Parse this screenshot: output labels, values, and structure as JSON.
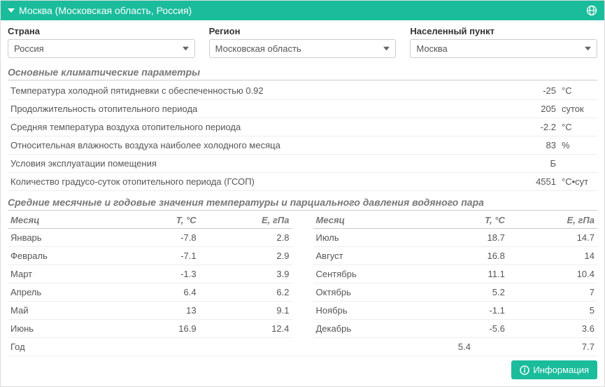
{
  "header": {
    "title": "Москва (Московская область, Россия)"
  },
  "selectors": {
    "country": {
      "label": "Страна",
      "value": "Россия"
    },
    "region": {
      "label": "Регион",
      "value": "Московская область"
    },
    "city": {
      "label": "Населенный пункт",
      "value": "Москва"
    }
  },
  "params_title": "Основные климатические параметры",
  "params": [
    {
      "name": "Температура холодной пятидневки с обеспеченностью 0.92",
      "value": "-25",
      "unit": "°C"
    },
    {
      "name": "Продолжительность отопительного периода",
      "value": "205",
      "unit": "суток"
    },
    {
      "name": "Средняя температура воздуха отопительного периода",
      "value": "-2.2",
      "unit": "°C"
    },
    {
      "name": "Относительная влажность воздуха наиболее холодного месяца",
      "value": "83",
      "unit": "%"
    },
    {
      "name": "Условия эксплуатации помещения",
      "value": "Б",
      "unit": ""
    },
    {
      "name": "Количество градусо-суток отопительного периода (ГСОП)",
      "value": "4551",
      "unit": "°C•сут"
    }
  ],
  "monthly_title": "Средние месячные и годовые значения температуры и парциального давления водяного пара",
  "monthly_headers": {
    "month": "Месяц",
    "t": "T, °C",
    "e": "E, гПа"
  },
  "monthly_left": [
    {
      "month": "Январь",
      "t": "-7.8",
      "e": "2.8"
    },
    {
      "month": "Февраль",
      "t": "-7.1",
      "e": "2.9"
    },
    {
      "month": "Март",
      "t": "-1.3",
      "e": "3.9"
    },
    {
      "month": "Апрель",
      "t": "6.4",
      "e": "6.2"
    },
    {
      "month": "Май",
      "t": "13",
      "e": "9.1"
    },
    {
      "month": "Июнь",
      "t": "16.9",
      "e": "12.4"
    }
  ],
  "monthly_right": [
    {
      "month": "Июль",
      "t": "18.7",
      "e": "14.7"
    },
    {
      "month": "Август",
      "t": "16.8",
      "e": "14"
    },
    {
      "month": "Сентябрь",
      "t": "11.1",
      "e": "10.4"
    },
    {
      "month": "Октябрь",
      "t": "5.2",
      "e": "7"
    },
    {
      "month": "Ноябрь",
      "t": "-1.1",
      "e": "5"
    },
    {
      "month": "Декабрь",
      "t": "-5.6",
      "e": "3.6"
    }
  ],
  "year": {
    "label": "Год",
    "t": "5.4",
    "e": "7.7"
  },
  "footer": {
    "info": "Информация"
  }
}
